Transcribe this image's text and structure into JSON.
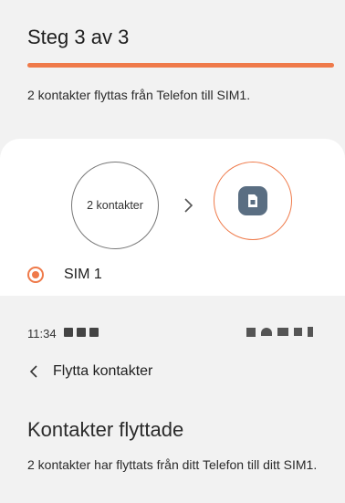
{
  "step_screen": {
    "title": "Steg 3 av 3",
    "progress": 1.0,
    "description": "2 kontakter flyttas från Telefon till SIM1.",
    "source_label": "2 kontakter",
    "target_icon": "sim-card-icon",
    "option_label": "SIM 1",
    "option_selected": true
  },
  "status_bar": {
    "time": "11:34"
  },
  "result_screen": {
    "app_title": "Flytta kontakter",
    "heading": "Kontakter flyttade",
    "description": "2 kontakter har flyttats från ditt Telefon till ditt SIM1."
  },
  "colors": {
    "accent": "#ef7a4a",
    "sim_icon": "#5a6e82"
  }
}
